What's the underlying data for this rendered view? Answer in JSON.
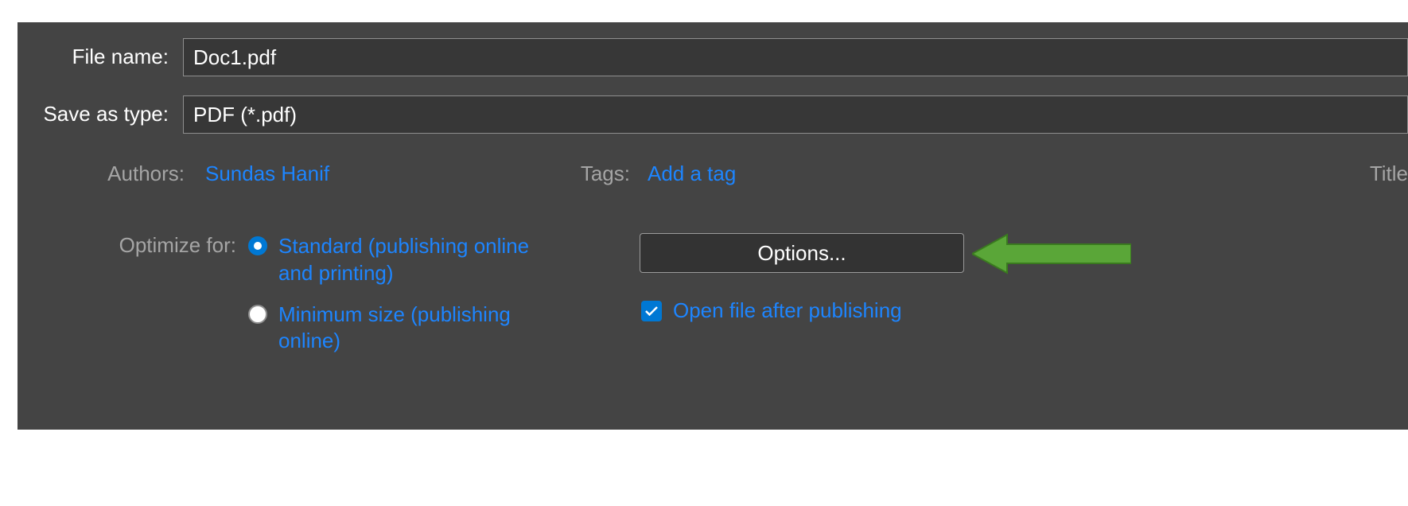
{
  "file": {
    "name_label": "File name:",
    "name_value": "Doc1.pdf",
    "type_label": "Save as type:",
    "type_value": "PDF (*.pdf)"
  },
  "meta": {
    "authors_label": "Authors:",
    "authors_value": "Sundas Hanif",
    "tags_label": "Tags:",
    "tags_value": "Add a tag",
    "title_label": "Title"
  },
  "optimize": {
    "label": "Optimize for:",
    "options": {
      "standard": "Standard (publishing online and printing)",
      "minimum": "Minimum size (publishing online)"
    },
    "selected": "standard"
  },
  "buttons": {
    "options": "Options..."
  },
  "checkbox": {
    "open_after": "Open file after publishing",
    "checked": true
  },
  "colors": {
    "link": "#1d85ff",
    "accent": "#0078d4",
    "panel_bg": "#444444",
    "input_bg": "#373737",
    "arrow": "#4c9a2a"
  }
}
